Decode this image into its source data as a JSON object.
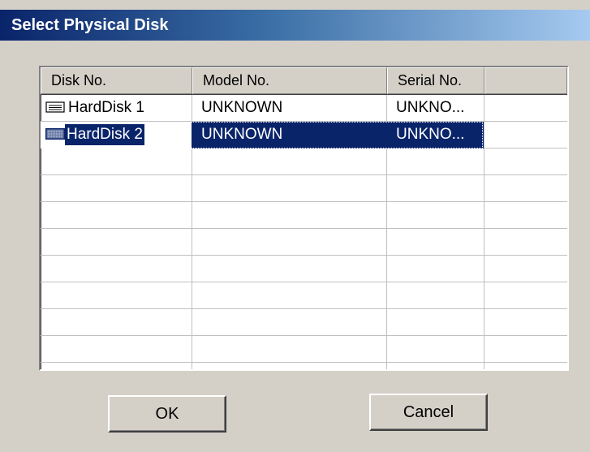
{
  "window": {
    "title": "Select Physical Disk"
  },
  "list": {
    "columns": [
      "Disk No.",
      "Model No.",
      "Serial No.",
      ""
    ],
    "rows": [
      {
        "disk": "HardDisk 1",
        "model": "UNKNOWN",
        "serial": "UNKNO...",
        "icon": "hard-disk-icon",
        "selected": false
      },
      {
        "disk": "HardDisk 2",
        "model": "UNKNOWN",
        "serial": "UNKNO...",
        "icon": "hard-disk-icon",
        "selected": true
      }
    ]
  },
  "buttons": {
    "ok_label": "OK",
    "cancel_label": "Cancel"
  },
  "colors": {
    "title_gradient_start": "#0a246a",
    "title_gradient_end": "#a6caf0",
    "selection": "#0a246a",
    "face": "#d4d0c8"
  }
}
